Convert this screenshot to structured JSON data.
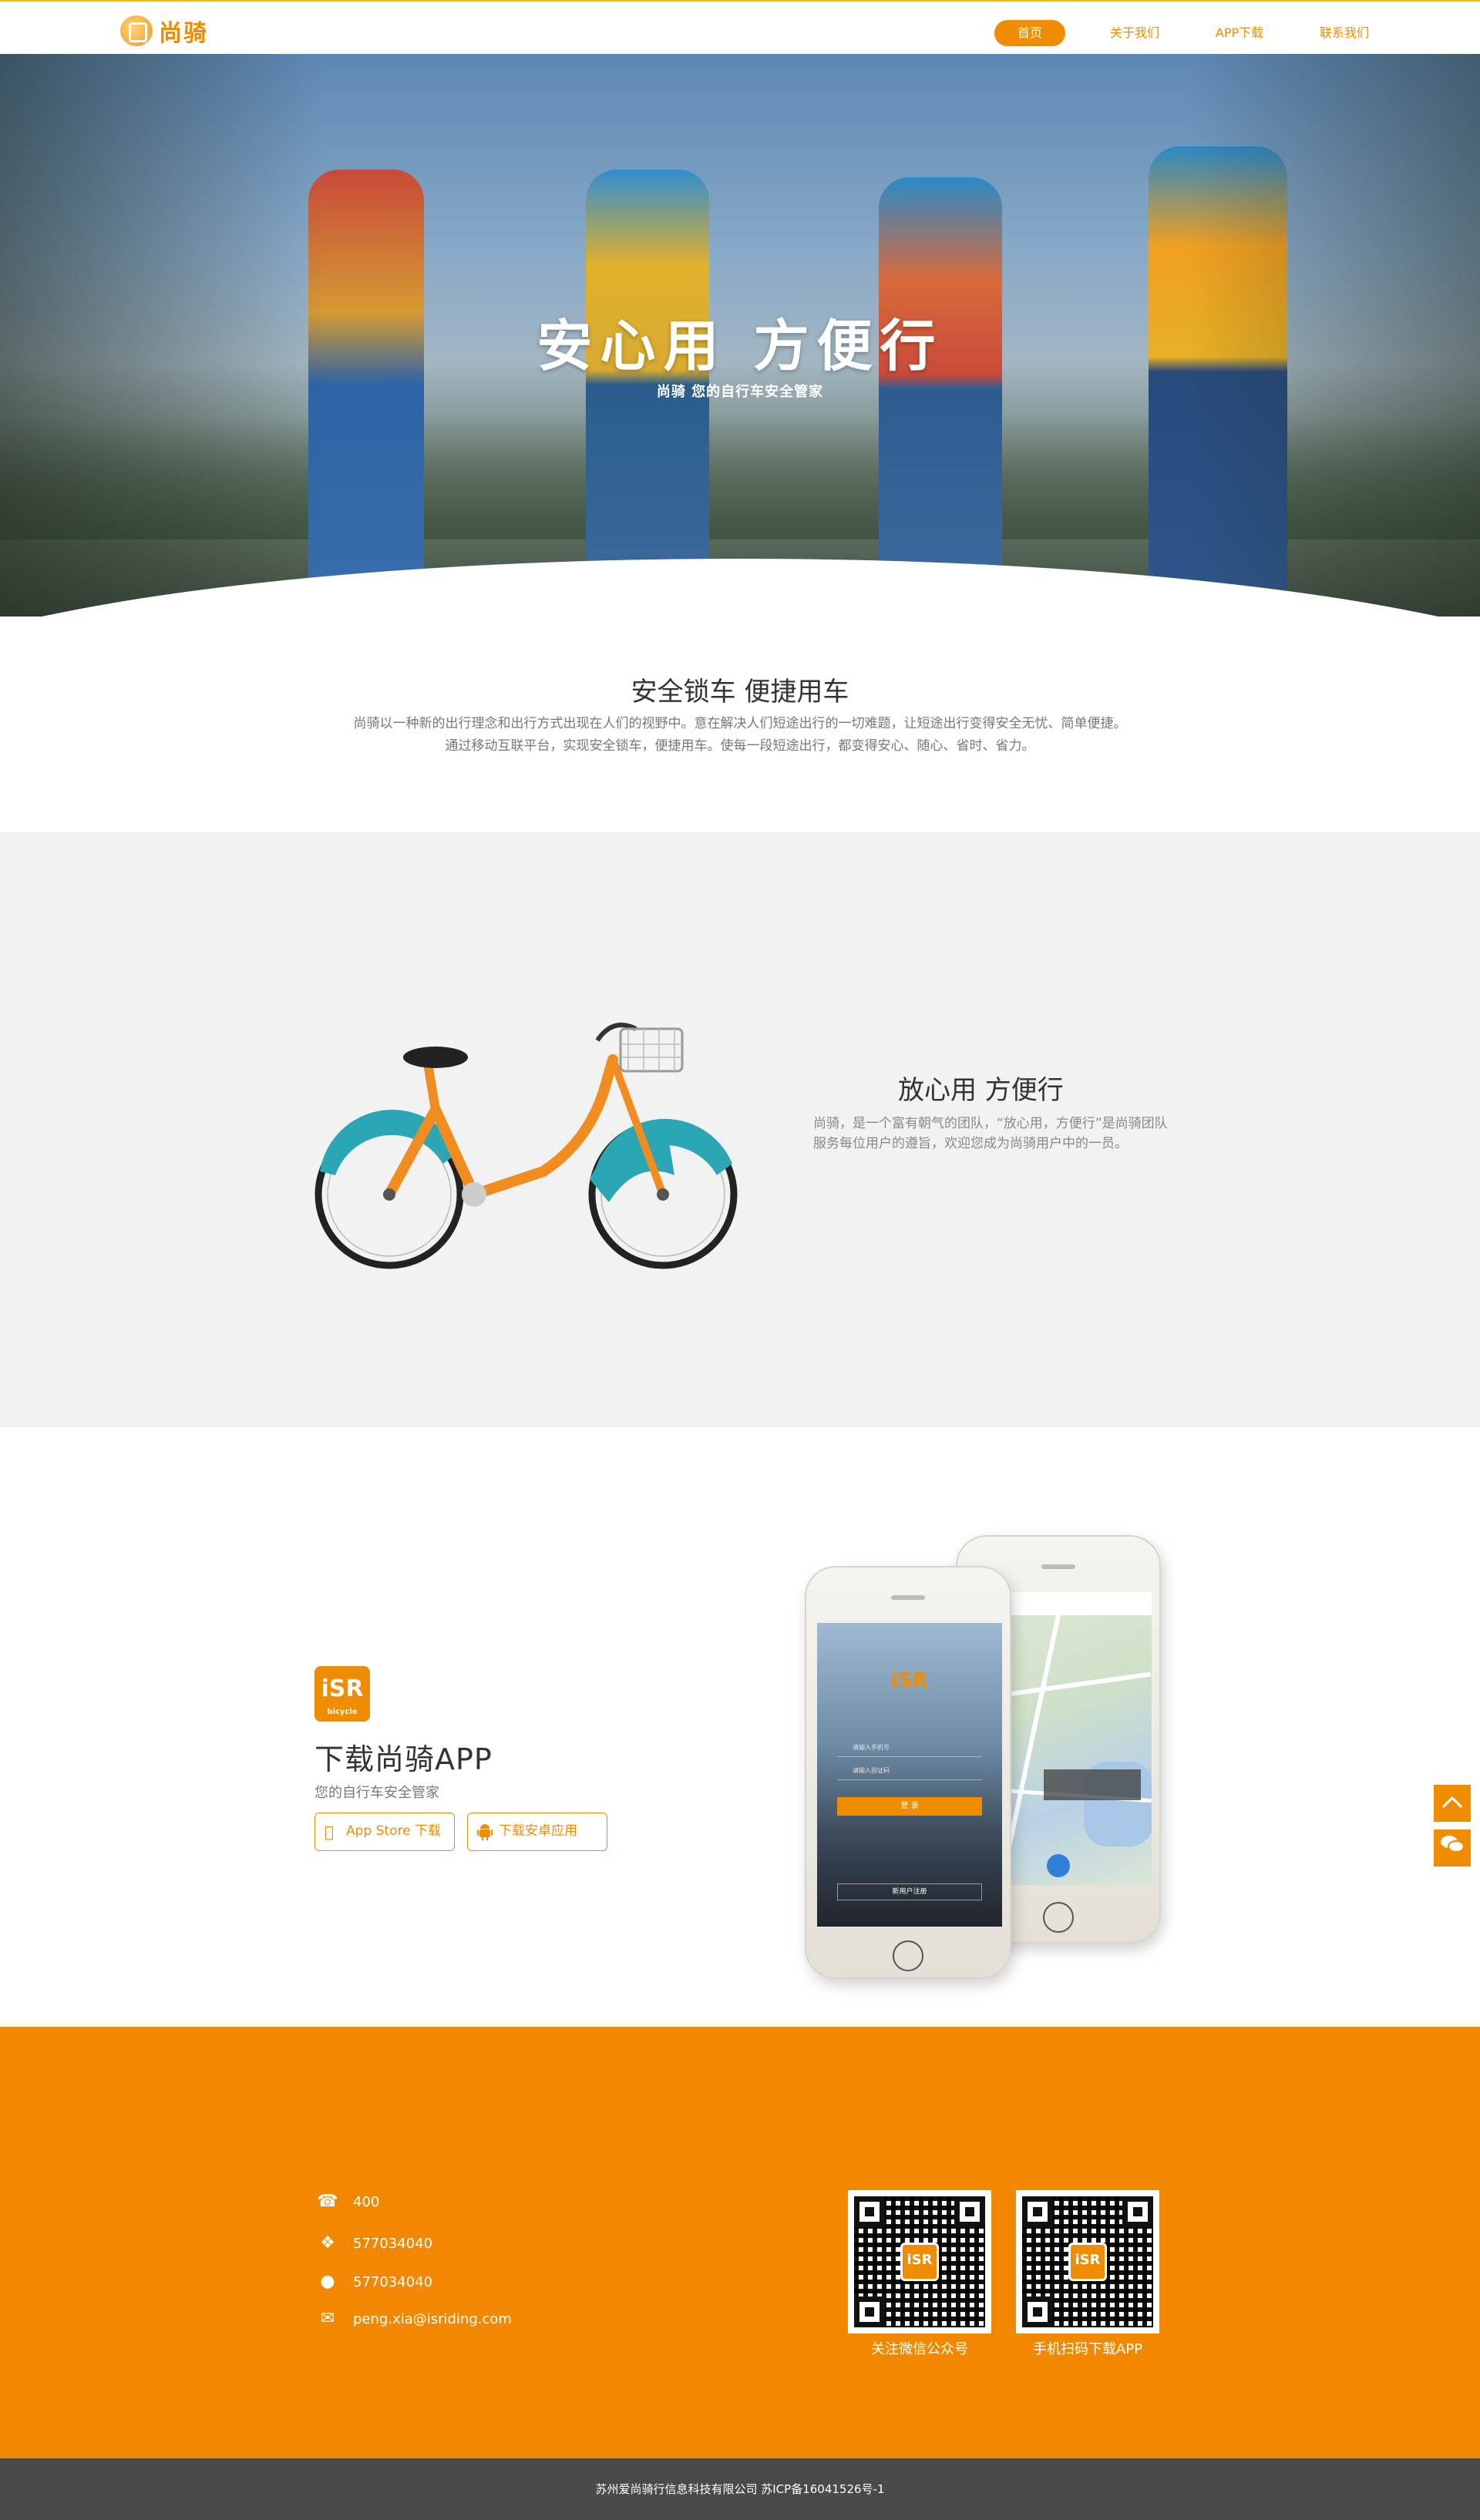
{
  "brand": {
    "name": "尚骑",
    "accent": "#f08c00"
  },
  "nav": {
    "items": [
      {
        "label": "首页",
        "active": true
      },
      {
        "label": "关于我们",
        "active": false
      },
      {
        "label": "APP下载",
        "active": false
      },
      {
        "label": "联系我们",
        "active": false
      }
    ]
  },
  "hero": {
    "title": "安心用 方便行",
    "subtitle": "尚骑   您的自行车安全管家"
  },
  "intro": {
    "title": "安全锁车 便捷用车",
    "line1": "尚骑以一种新的出行理念和出行方式出现在人们的视野中。意在解决人们短途出行的一切难题，让短途出行变得安全无忧、简单便捷。",
    "line2": "通过移动互联平台，实现安全锁车，便捷用车。使每一段短途出行，都变得安心、随心、省时、省力。"
  },
  "feature": {
    "title": "放心用 方便行",
    "text": "尚骑，是一个富有朝气的团队，“放心用，方便行”是尚骑团队服务每位用户的遵旨，欢迎您成为尚骑用户中的一员。"
  },
  "app": {
    "icon_text": "iSR",
    "icon_sub": "bicycle",
    "title": "下载尚骑APP",
    "subtitle": "您的自行车安全管家",
    "ios_button": "App Store 下载",
    "android_button": "下载安卓应用",
    "login": {
      "logo": "iSR",
      "phone_placeholder": "请输入手机号",
      "password_placeholder": "请输入验证码",
      "login_button": "登 录",
      "register_button": "新用户注册"
    }
  },
  "contact": {
    "phone": "400",
    "wechat": "577034040",
    "qq": "577034040",
    "email": "peng.xia@isriding.com",
    "qr1_caption": "关注微信公众号",
    "qr2_caption": "手机扫码下载APP",
    "qr_logo": "iSR"
  },
  "footer": {
    "copyright": "苏州爱尚骑行信息科技有限公司    苏ICP备16041526号-1"
  },
  "side": {
    "top_icon": "arrow-up-icon",
    "wechat_icon": "wechat-icon"
  }
}
